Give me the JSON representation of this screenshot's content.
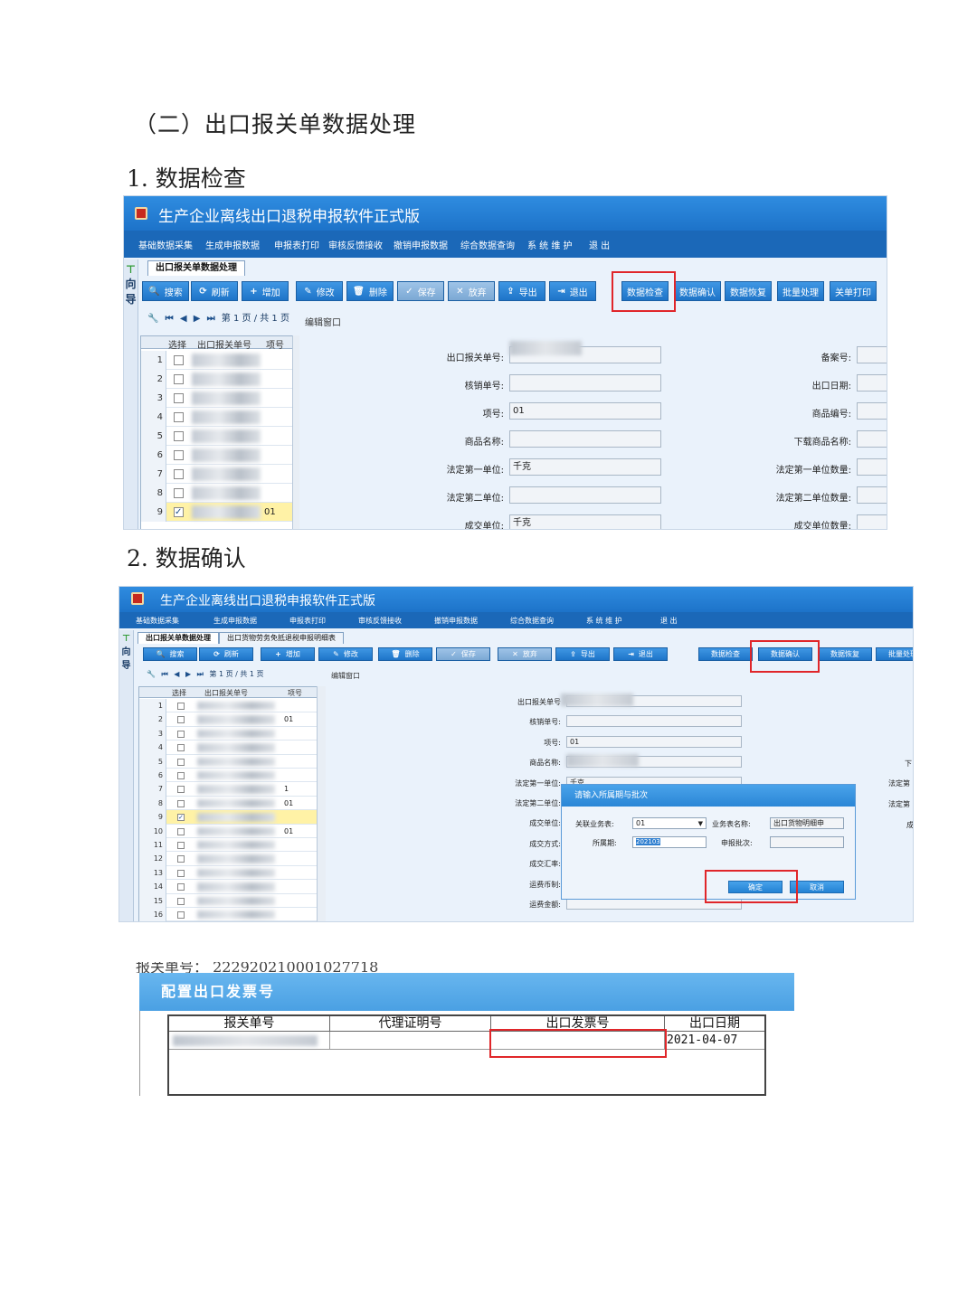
{
  "headings": {
    "section": "（二）出口报关单数据处理",
    "step1": "1. 数据检查",
    "step2": "2. 数据确认"
  },
  "app": {
    "title": "生产企业离线出口退税申报软件正式版",
    "menu": [
      "基础数据采集",
      "生成申报数据",
      "申报表打印",
      "审核反馈接收",
      "撤销申报数据",
      "综合数据查询",
      "系 统 维 护",
      "退 出"
    ],
    "sidenav": [
      "向",
      "导"
    ],
    "toolbar": [
      "搜索",
      "刷新",
      "增加",
      "修改",
      "删除",
      "保存",
      "放弃",
      "导出",
      "退出",
      "数据检查",
      "数据确认",
      "数据恢复",
      "批量处理",
      "关单打印"
    ],
    "toolbar_icons": [
      "search-icon",
      "refresh-icon",
      "plus-icon",
      "edit-icon",
      "delete-icon",
      "check-icon",
      "close-icon",
      "upload-icon",
      "exit-icon"
    ],
    "pager": "第 1 页 / 共 1 页",
    "edit_window": "编辑窗口",
    "grid_headers": [
      "选择",
      "出口报关单号",
      "项号"
    ],
    "colors": {
      "title": "#1d73c9",
      "button": "#1e74c8",
      "highlight": "#e0262a",
      "selected_row": "#fff2a6"
    }
  },
  "screen1": {
    "tab": "出口报关单数据处理",
    "rows": [
      "1",
      "2",
      "3",
      "4",
      "5",
      "6",
      "7",
      "8",
      "9"
    ],
    "selected_item": "01",
    "left_fields": [
      {
        "label": "出口报关单号:",
        "value": ""
      },
      {
        "label": "核销单号:",
        "value": ""
      },
      {
        "label": "项号:",
        "value": "01"
      },
      {
        "label": "商品名称:",
        "value": ""
      },
      {
        "label": "法定第一单位:",
        "value": "千克"
      },
      {
        "label": "法定第二单位:",
        "value": ""
      },
      {
        "label": "成交单位:",
        "value": "千克"
      }
    ],
    "right_fields": [
      "备案号:",
      "出口日期:",
      "商品编号:",
      "下载商品名称:",
      "法定第一单位数量:",
      "法定第二单位数量:",
      "成交单位数量:"
    ]
  },
  "screen2": {
    "tab": "出口报关单数据处理",
    "tab2": "出口货物劳务免抵退税申报明细表",
    "rows": [
      "1",
      "2",
      "3",
      "4",
      "5",
      "6",
      "7",
      "8",
      "9",
      "10",
      "11",
      "12",
      "13",
      "14",
      "15",
      "16"
    ],
    "items": {
      "2": "01",
      "7": "1",
      "8": "01",
      "10": "01"
    },
    "left_fields": [
      "出口报关单号",
      "核销单号:",
      "项号:",
      "商品名称:",
      "法定第一单位:",
      "法定第二单位:",
      "成交单位:",
      "成交方式:",
      "成交汇率:",
      "运费币制:",
      "运费金额:"
    ],
    "field_values": {
      "项号:": "01",
      "法定第一单位:": "千克"
    },
    "right_fields": [
      "下",
      "法定第",
      "法定第",
      "成"
    ],
    "dialog": {
      "title": "请输入所属期与批次",
      "related_label": "关联业务表:",
      "related_value": "01",
      "bizname_label": "业务表名称:",
      "bizname_value": "出口货物明细申",
      "period_label": "所属期:",
      "period_value": "202103",
      "batch_label": "申报批次:",
      "ok": "确定",
      "cancel": "取消"
    }
  },
  "invoice": {
    "top_text": "报关单号：  222920210001027718",
    "title": "配置出口发票号",
    "headers": [
      "报关单号",
      "代理证明号",
      "出口发票号",
      "出口日期"
    ],
    "date": "2021-04-07"
  }
}
